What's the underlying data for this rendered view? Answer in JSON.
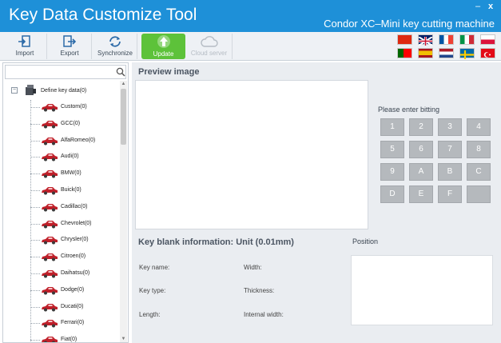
{
  "window": {
    "title": "Key Data Customize Tool",
    "subtitle": "Condor XC–Mini key cutting machine",
    "minimize": "–",
    "close": "x"
  },
  "toolbar": {
    "import": "Import",
    "export": "Export",
    "synchronize": "Synchronize",
    "update": "Update",
    "cloud_server": "Cloud server"
  },
  "languages": [
    "chinese",
    "english",
    "french",
    "italian",
    "polish",
    "portuguese",
    "spanish",
    "dutch",
    "swedish",
    "turkish"
  ],
  "tree": {
    "search_value": "",
    "root": "Define key data(0)",
    "items": [
      "Custom(0)",
      "GCC(0)",
      "AlfaRomeo(0)",
      "Audi(0)",
      "BMW(0)",
      "Buick(0)",
      "Cadillac(0)",
      "Chevrolet(0)",
      "Chrysler(0)",
      "Citroen(0)",
      "Daihatsu(0)",
      "Dodge(0)",
      "Ducati(0)",
      "Ferrari(0)",
      "Fiat(0)"
    ]
  },
  "preview": {
    "title": "Preview image"
  },
  "bitting": {
    "label": "Please enter bitting",
    "keys": [
      "1",
      "2",
      "3",
      "4",
      "5",
      "6",
      "7",
      "8",
      "9",
      "A",
      "B",
      "C",
      "D",
      "E",
      "F",
      ""
    ]
  },
  "blank_info": {
    "title": "Key blank information: Unit (0.01mm)",
    "key_name": "Key name:",
    "key_type": "Key type:",
    "length": "Length:",
    "width": "Width:",
    "thickness": "Thickness:",
    "internal_width": "Internal width:"
  },
  "position": {
    "label": "Position"
  },
  "colors": {
    "title_bar": "#1e90d8",
    "update_green": "#5dc23a",
    "car_red": "#c0202a",
    "key_gray": "#b5b9bd"
  }
}
